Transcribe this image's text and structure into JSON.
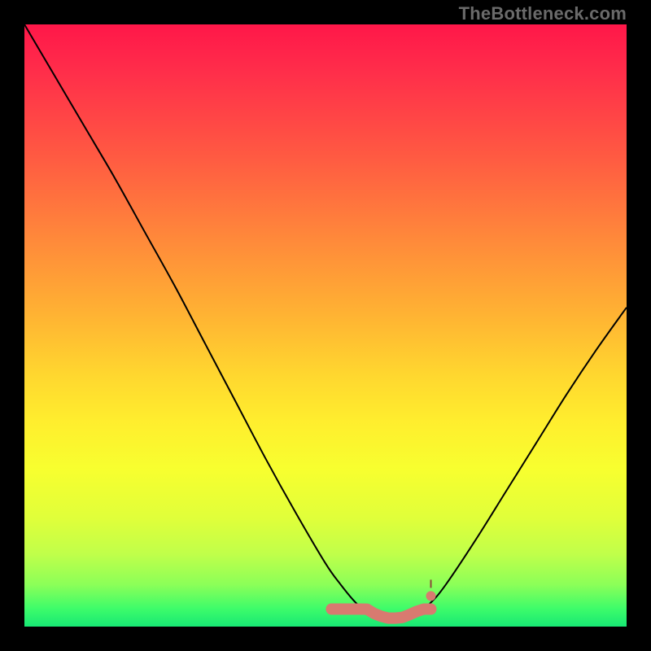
{
  "watermark": "TheBottleneck.com",
  "chart_data": {
    "type": "line",
    "title": "",
    "xlabel": "",
    "ylabel": "",
    "xlim": [
      0,
      1
    ],
    "ylim": [
      0,
      1
    ],
    "series": [
      {
        "name": "bottleneck-curve",
        "x": [
          0.0,
          0.05,
          0.1,
          0.15,
          0.2,
          0.25,
          0.3,
          0.35,
          0.4,
          0.45,
          0.5,
          0.525,
          0.55,
          0.575,
          0.6,
          0.625,
          0.65,
          0.675,
          0.7,
          0.75,
          0.8,
          0.85,
          0.9,
          0.95,
          1.0
        ],
        "y": [
          1.0,
          0.915,
          0.83,
          0.745,
          0.655,
          0.565,
          0.47,
          0.375,
          0.28,
          0.19,
          0.105,
          0.07,
          0.04,
          0.02,
          0.01,
          0.01,
          0.02,
          0.04,
          0.07,
          0.145,
          0.225,
          0.305,
          0.385,
          0.46,
          0.53
        ]
      }
    ],
    "annotations": [
      {
        "name": "optimal-range",
        "x_start": 0.51,
        "x_end": 0.675,
        "y": 0.025
      }
    ]
  }
}
